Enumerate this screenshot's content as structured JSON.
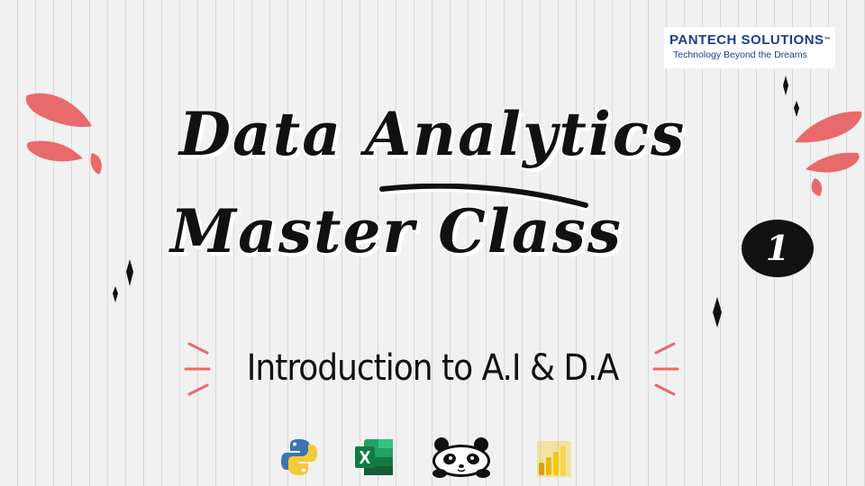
{
  "slide": {
    "title_line1": "Data Analytics",
    "title_line2": "Master Class",
    "badge_number": "1",
    "subtitle": "Introduction to A.I & D.A"
  },
  "logo": {
    "name": "PANTECH SOLUTIONS",
    "trademark": "™",
    "tagline": "Technology Beyond the Dreams"
  },
  "icons": [
    "python-icon",
    "excel-icon",
    "pandas-panda-icon",
    "power-bi-icon"
  ],
  "colors": {
    "background": "#f1f1f1",
    "accent_coral": "#e86a6a",
    "text": "#111111",
    "logo_blue": "#1f3c95"
  }
}
